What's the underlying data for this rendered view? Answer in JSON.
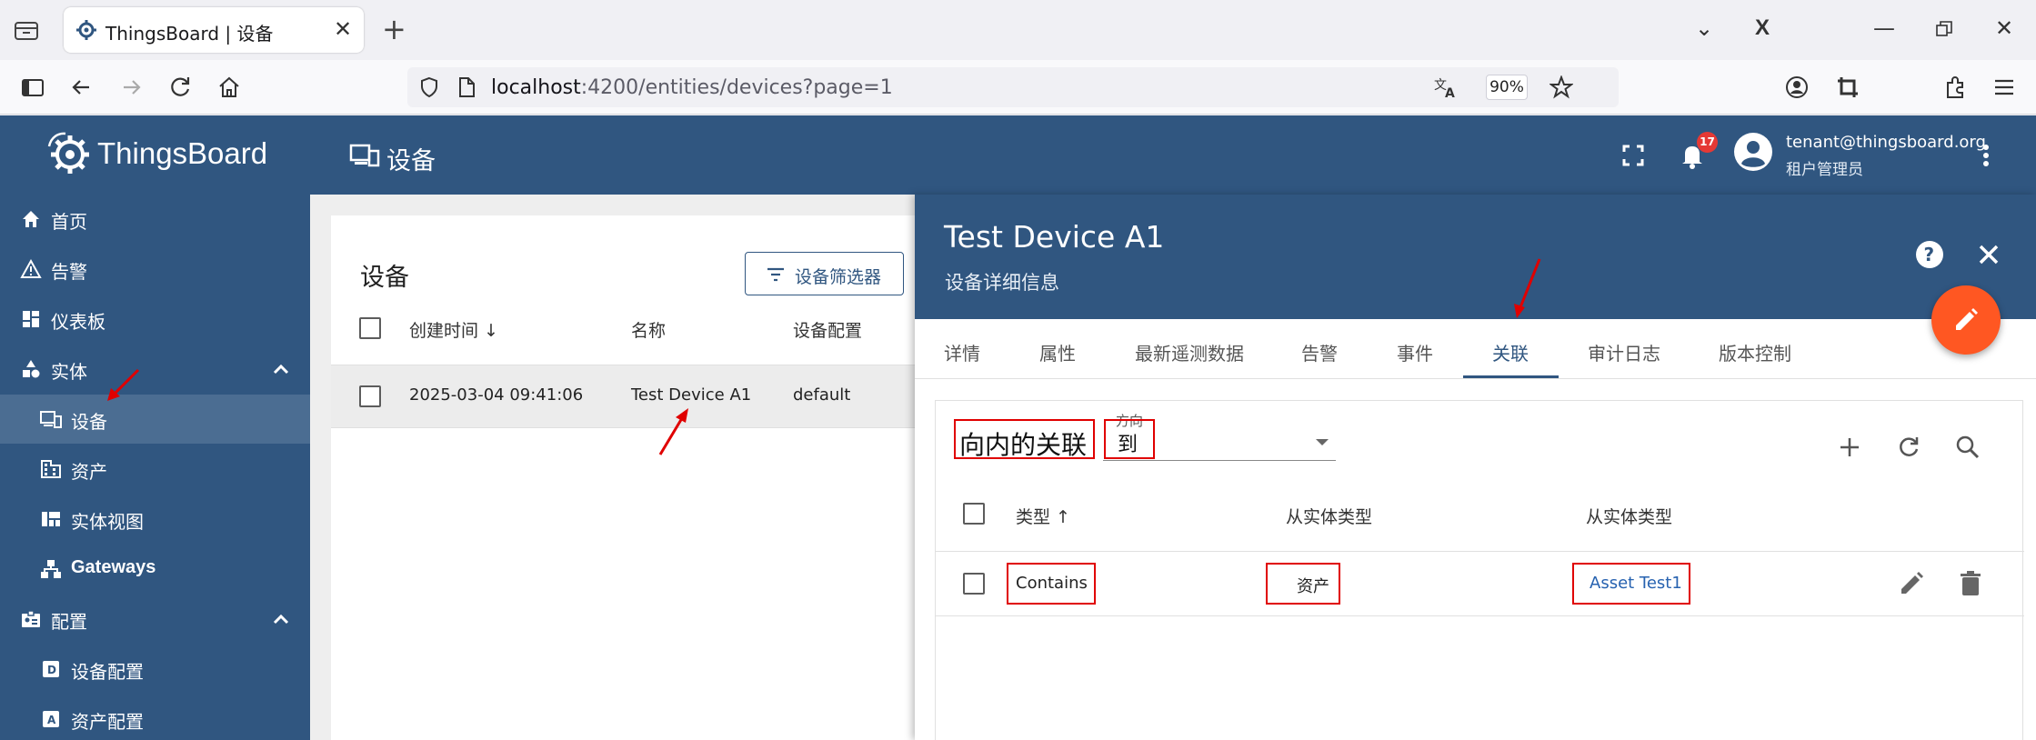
{
  "browser": {
    "tab_title": "ThingsBoard | 设备",
    "url_host": "localhost",
    "url_rest": ":4200/entities/devices?page=1",
    "zoom": "90%"
  },
  "app": {
    "logo_text": "ThingsBoard",
    "page_title": "设备",
    "notifications_count": "17",
    "user_email": "tenant@thingsboard.org",
    "user_role": "租户管理员"
  },
  "sidebar": {
    "items": [
      {
        "label": "首页",
        "icon": "home-icon"
      },
      {
        "label": "告警",
        "icon": "warning-icon"
      },
      {
        "label": "仪表板",
        "icon": "dashboard-icon"
      },
      {
        "label": "实体",
        "icon": "shapes-icon"
      },
      {
        "label": "设备",
        "icon": "device-icon"
      },
      {
        "label": "资产",
        "icon": "domain-icon"
      },
      {
        "label": "实体视图",
        "icon": "view-quilt-icon"
      },
      {
        "label": "Gateways",
        "icon": "gateway-icon"
      },
      {
        "label": "配置",
        "icon": "badge-icon"
      },
      {
        "label": "设备配置",
        "icon": "device-profile-icon"
      },
      {
        "label": "资产配置",
        "icon": "asset-profile-icon"
      }
    ]
  },
  "devices": {
    "title": "设备",
    "filter_button": "设备筛选器",
    "columns": [
      "创建时间",
      "名称",
      "设备配置"
    ],
    "rows": [
      {
        "created": "2025-03-04 09:41:06",
        "name": "Test Device A1",
        "profile": "default"
      }
    ]
  },
  "details": {
    "title": "Test Device A1",
    "subtitle": "设备详细信息",
    "tabs": [
      "详情",
      "属性",
      "最新遥测数据",
      "告警",
      "事件",
      "关联",
      "审计日志",
      "版本控制"
    ],
    "active_tab": "关联",
    "relations": {
      "heading": "向内的关联",
      "direction_label": "方向",
      "direction_value": "到",
      "columns": [
        "类型",
        "从实体类型",
        "从实体类型"
      ],
      "rows": [
        {
          "type": "Contains",
          "from_type": "资产",
          "from_name": "Asset Test1"
        }
      ]
    }
  },
  "colors": {
    "primary": "#305680",
    "accent": "#ff5722",
    "annotation": "#e00000"
  }
}
